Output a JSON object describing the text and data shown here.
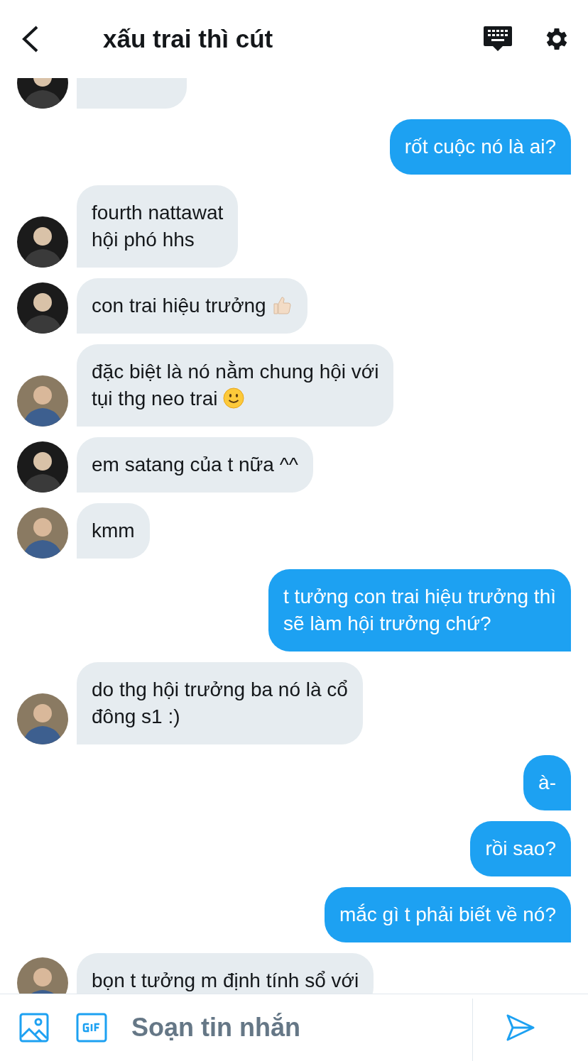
{
  "header": {
    "title": "xấu trai thì cút"
  },
  "messages": [
    {
      "kind": "incoming",
      "avatar": {
        "kind": "dark"
      },
      "clipped": true
    },
    {
      "kind": "outgoing",
      "text": "rốt cuộc nó là ai?"
    },
    {
      "kind": "incoming",
      "avatar": {
        "kind": "dark"
      },
      "text": "fourth nattawat\nhội phó hhs"
    },
    {
      "kind": "incoming",
      "avatar": {
        "kind": "dark"
      },
      "text": "con trai hiệu trưởng",
      "emoji": {
        "kind": "thumbs_up"
      }
    },
    {
      "kind": "incoming",
      "avatar": {
        "kind": "denim"
      },
      "text": "đặc biệt là nó nằm chung hội với\ntụi thg neo trai",
      "emoji": {
        "kind": "smile"
      }
    },
    {
      "kind": "incoming",
      "avatar": {
        "kind": "dark"
      },
      "text": "em satang của t nữa ^^"
    },
    {
      "kind": "incoming",
      "avatar": {
        "kind": "denim"
      },
      "text": "kmm"
    },
    {
      "kind": "outgoing",
      "text": "t tưởng con trai hiệu trưởng thì\nsẽ làm hội trưởng chứ?"
    },
    {
      "kind": "incoming",
      "avatar": {
        "kind": "denim"
      },
      "text": "do thg hội trưởng ba nó là cổ\nđông s1 :)"
    },
    {
      "kind": "outgoing",
      "text": "à-"
    },
    {
      "kind": "outgoing",
      "text": "rồi sao?"
    },
    {
      "kind": "outgoing",
      "text": "mắc gì t phải biết về nó?"
    },
    {
      "kind": "incoming",
      "avatar": {
        "kind": "denim"
      },
      "text": "bọn t tưởng m định tính sổ với"
    }
  ],
  "composer": {
    "placeholder": "Soạn tin nhắn"
  }
}
